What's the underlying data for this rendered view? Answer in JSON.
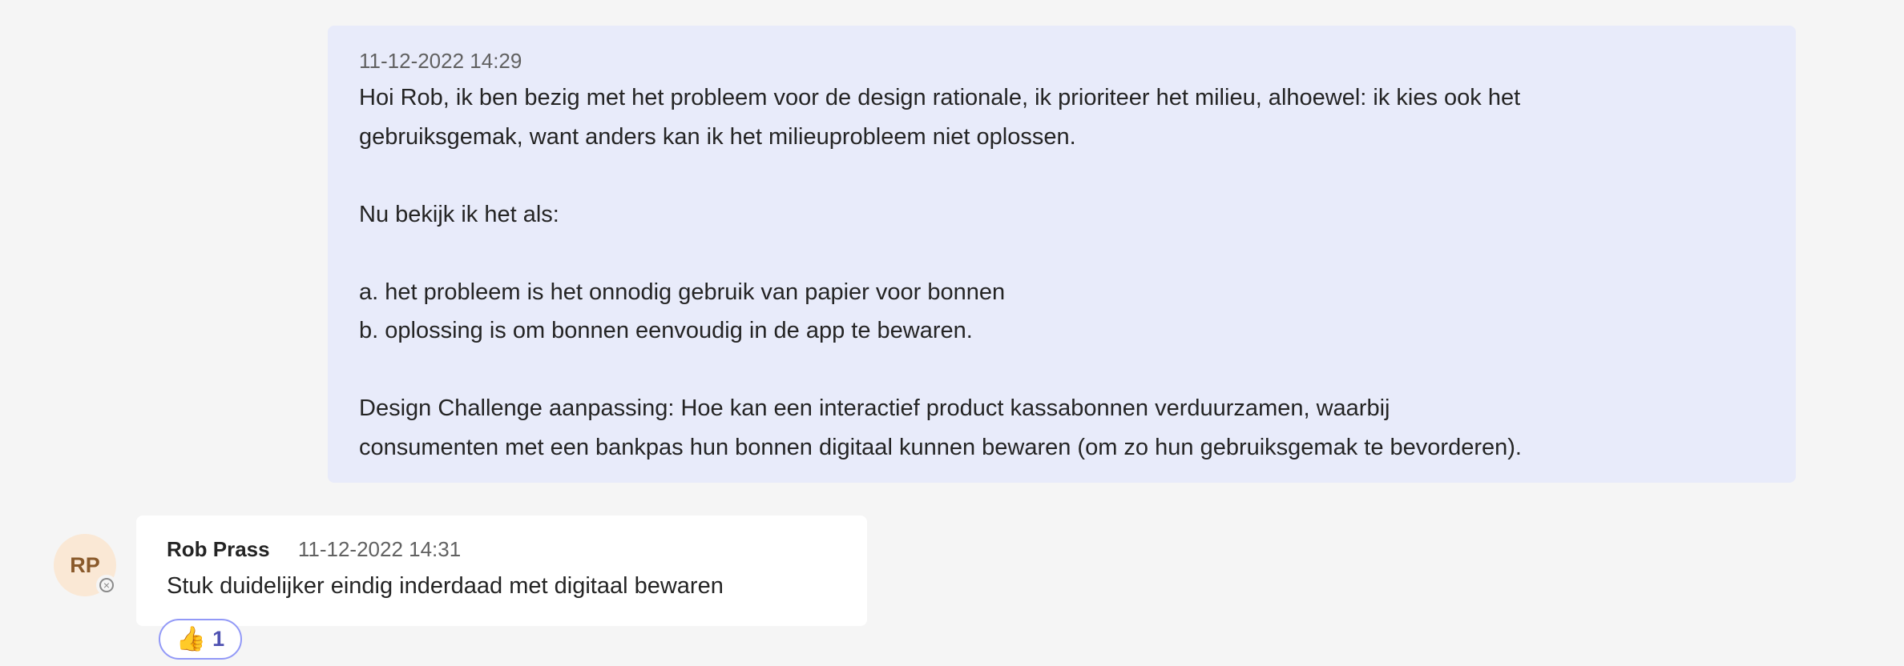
{
  "messages": [
    {
      "timestamp": "11-12-2022 14:29",
      "text": "Hoi Rob, ik ben bezig met het probleem voor de design rationale, ik prioriteer het milieu, alhoewel: ik kies ook het\ngebruiksgemak, want anders kan ik het milieuprobleem niet oplossen.\n\nNu bekijk ik het als:\n\na. het probleem is het onnodig gebruik van papier voor bonnen\nb. oplossing is om bonnen eenvoudig in de app te bewaren.\n\nDesign Challenge aanpassing: Hoe kan een interactief product kassabonnen verduurzamen, waarbij\nconsumenten met een bankpas hun bonnen digitaal kunnen bewaren (om zo hun gebruiksgemak te bevorderen)."
    },
    {
      "avatar_initials": "RP",
      "sender": "Rob Prass",
      "timestamp": "11-12-2022 14:31",
      "text": "Stuk duidelijker eindig inderdaad met digitaal bewaren",
      "reaction": {
        "icon": "thumbs-up-icon",
        "emoji": "👍",
        "count": "1"
      },
      "status_icon": "offline-status-icon"
    }
  ]
}
